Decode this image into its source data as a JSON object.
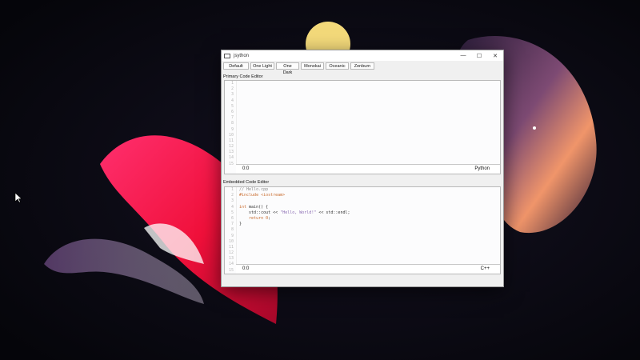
{
  "window": {
    "title": "jsython",
    "controls": {
      "minimize": "—",
      "maximize": "☐",
      "close": "✕"
    }
  },
  "themes": [
    "Default",
    "One Light",
    "One Dark",
    "Monokai",
    "Oceanic",
    "Zenburn"
  ],
  "primary_editor": {
    "label": "Primary Code Editor",
    "line_numbers": [
      "1",
      "2",
      "3",
      "4",
      "5",
      "6",
      "7",
      "8",
      "9",
      "10",
      "11",
      "12",
      "13",
      "14",
      "15"
    ],
    "cursor_position": "0:0",
    "language": "Python"
  },
  "embedded_editor": {
    "label": "Embedded Code Editor",
    "line_numbers": [
      "1",
      "2",
      "3",
      "4",
      "5",
      "6",
      "7",
      "8",
      "9",
      "10",
      "11",
      "12",
      "13",
      "14",
      "15"
    ],
    "code": {
      "comment": "// Hello.cpp",
      "include": "#include <iostream>",
      "main_kw": "int",
      "main_rest": " main() {",
      "cout_a": "    std::cout << ",
      "cout_str": "\"Hello, World!\"",
      "cout_b": " << std::endl;",
      "return_kw": "    return",
      "return_num": " 0",
      "return_end": ";",
      "close": "}"
    },
    "cursor_position": "0:0",
    "language": "C++"
  },
  "colors": {
    "comment": "#8a8a8a",
    "keyword": "#c86a2c",
    "string": "#8a6bb3",
    "line_number": "#b8b8b8"
  },
  "icons": [
    "app-icon",
    "minimize-icon",
    "maximize-icon",
    "close-icon",
    "mouse-cursor-icon"
  ]
}
